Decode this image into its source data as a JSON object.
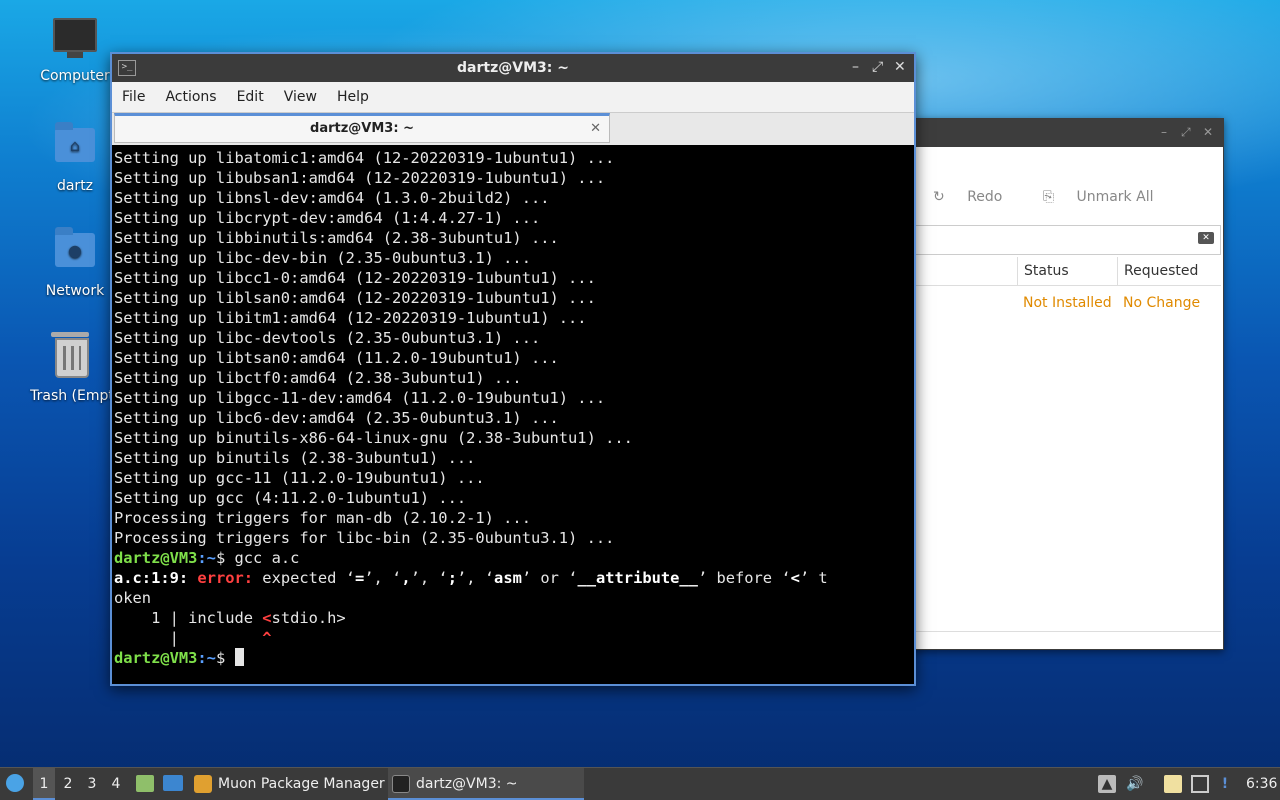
{
  "desktop": {
    "icons": [
      {
        "label": "Computer"
      },
      {
        "label": "dartz"
      },
      {
        "label": "Network"
      },
      {
        "label": "Trash (Empt"
      }
    ]
  },
  "muon": {
    "toolbar": {
      "redo": "Redo",
      "unmark_all": "Unmark All"
    },
    "columns": {
      "status": "Status",
      "requested": "Requested"
    },
    "row": {
      "status": "Not Installed",
      "requested": "No Change"
    }
  },
  "terminal": {
    "title": "dartz@VM3: ~",
    "menu": [
      "File",
      "Actions",
      "Edit",
      "View",
      "Help"
    ],
    "tab_label": "dartz@VM3: ~",
    "output_lines": [
      "Setting up libatomic1:amd64 (12-20220319-1ubuntu1) ...",
      "Setting up libubsan1:amd64 (12-20220319-1ubuntu1) ...",
      "Setting up libnsl-dev:amd64 (1.3.0-2build2) ...",
      "Setting up libcrypt-dev:amd64 (1:4.4.27-1) ...",
      "Setting up libbinutils:amd64 (2.38-3ubuntu1) ...",
      "Setting up libc-dev-bin (2.35-0ubuntu3.1) ...",
      "Setting up libcc1-0:amd64 (12-20220319-1ubuntu1) ...",
      "Setting up liblsan0:amd64 (12-20220319-1ubuntu1) ...",
      "Setting up libitm1:amd64 (12-20220319-1ubuntu1) ...",
      "Setting up libc-devtools (2.35-0ubuntu3.1) ...",
      "Setting up libtsan0:amd64 (11.2.0-19ubuntu1) ...",
      "Setting up libctf0:amd64 (2.38-3ubuntu1) ...",
      "Setting up libgcc-11-dev:amd64 (11.2.0-19ubuntu1) ...",
      "Setting up libc6-dev:amd64 (2.35-0ubuntu3.1) ...",
      "Setting up binutils-x86-64-linux-gnu (2.38-3ubuntu1) ...",
      "Setting up binutils (2.38-3ubuntu1) ...",
      "Setting up gcc-11 (11.2.0-19ubuntu1) ...",
      "Setting up gcc (4:11.2.0-1ubuntu1) ...",
      "Processing triggers for man-db (2.10.2-1) ...",
      "Processing triggers for libc-bin (2.35-0ubuntu3.1) ..."
    ],
    "prompt_user": "dartz@VM3",
    "prompt_path": ":~",
    "prompt_symbol": "$",
    "command": " gcc a.c",
    "error": {
      "location": "a.c:1:9:",
      "label": "error:",
      "msg_a": " expected ‘",
      "t1": "=",
      "s1": "’, ‘",
      "t2": ",",
      "s2": "’, ‘",
      "t3": ";",
      "s3": "’, ‘",
      "t4": "asm",
      "s4": "’ or ‘",
      "t5": "__attribute__",
      "s5": "’ before ‘",
      "t6": "<",
      "s6": "’ t",
      "wrap": "oken",
      "code_prefix": "    1 | include ",
      "code_mark": "<",
      "code_rest": "stdio.h>",
      "marker_prefix": "      |         ",
      "marker": "^"
    }
  },
  "taskbar": {
    "workspaces": [
      "1",
      "2",
      "3",
      "4"
    ],
    "tasks": [
      {
        "label": "Muon Package Manager"
      },
      {
        "label": "dartz@VM3: ~"
      }
    ],
    "clock": "6:36"
  }
}
